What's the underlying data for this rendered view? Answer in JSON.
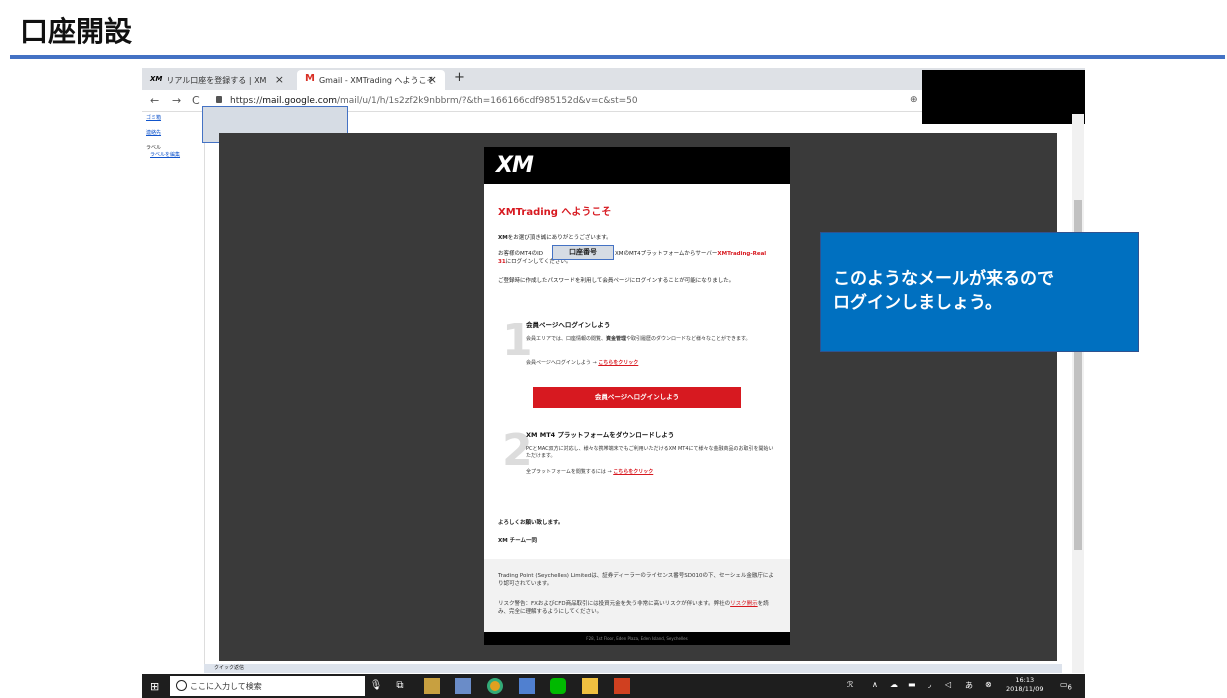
{
  "slide": {
    "title": "口座開設"
  },
  "browser": {
    "tabs": [
      {
        "favicon": "XM",
        "label": "リアル口座を登録する | XM",
        "close": "×"
      },
      {
        "favicon": "M",
        "label": "Gmail - XMTrading へようこそ",
        "close": "×"
      }
    ],
    "new_tab": "+",
    "nav": {
      "back": "←",
      "forward": "→",
      "reload": "C"
    },
    "url": {
      "scheme": "https://",
      "host": "mail.google.com",
      "path": "/mail/u/1/h/1s2zf2k9nbbrm/?&th=166166cdf985152d&v=c&st=50"
    },
    "zoom_icon": "⊕"
  },
  "gmail": {
    "nav_links": [
      "ゴミ箱",
      "連絡先"
    ],
    "labels_heading": "ラベル",
    "labels_edit": "ラベルを編集",
    "quick_reply": "クイック返信"
  },
  "email": {
    "logo": "XM",
    "welcome": "XMTrading へようこそ",
    "thanks_pre": "XM",
    "thanks": "をお選び頂き誠にありがとうございます。",
    "line1_pre": "お客様のMT4のID",
    "line1_mid": "XMのMT4プラットフォームからサーバー",
    "line1_server": "XMTrading-Real 31",
    "line1_post": "にログインしてください。",
    "account_number_label": "口座番号",
    "password_note": "ご登録時に作成したパスワードを利用して会員ページにログインすることが可能になりました。",
    "step1": {
      "num": "1",
      "title": "会員ページへログインしよう",
      "body_a": "会員エリアでは、口座情報の閲覧、",
      "body_bold": "資金管理",
      "body_b": "や取引履歴のダウンロードなど様々なことができます。",
      "link_pre": "会員ページへログインしよう → ",
      "link": "こちらをクリック"
    },
    "login_button": "会員ページへログインしよう",
    "step2": {
      "num": "2",
      "title": "XM MT4 プラットフォームをダウンロードしよう",
      "body": "PCとMAC双方に対応し、様々な携帯端末でもご利用いただけるXM MT4にて様々な金融商品のお取引を開始いただけます。",
      "link_pre": "全プラットフォームを閲覧するには → ",
      "link": "こちらをクリック"
    },
    "regards": "よろしくお願い致します。",
    "team": "XM チーム一同",
    "footer1": "Trading Point (Seychelles) Limitedは、証券ディーラーのライセンス番号SD010の下、セーシェル金融庁により認可されています。",
    "footer2_pre": "リスク警告：FXおよびCFD商品取引には投資元金を失う非常に高いリスクが伴います。弊社の",
    "footer2_link": "リスク開示",
    "footer2_post": "を読み、完全に理解するようにしてください。",
    "address": "F28, 1st Floor, Eden Plaza, Eden Island, Seychelles"
  },
  "callout": {
    "line1": "このようなメールが来るので",
    "line2": "ログインしましょう。"
  },
  "taskbar": {
    "search_placeholder": "ここに入力して検索",
    "time": "16:13",
    "date": "2018/11/09",
    "notifications": "6"
  }
}
